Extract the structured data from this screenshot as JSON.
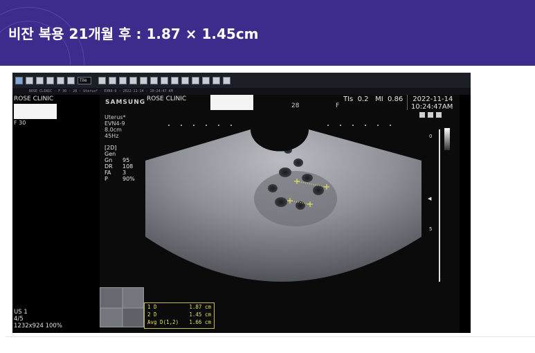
{
  "slide": {
    "title": "비잔 복용 21개월 후 :  1.87 × 1.45cm",
    "banner_color": "#3e2b8c"
  },
  "toolbar": {
    "buttons": [
      "patient-icon",
      "worklist-icon",
      "pointer-icon",
      "zoom-icon",
      "user-icon",
      "compare-icon",
      "tile-icon",
      "layout-icon",
      "grid-icon",
      "sound-icon",
      "export-icon",
      "print-icon",
      "window-icon",
      "print2-icon",
      "filter-icon",
      "report-icon",
      "capture-icon",
      "settings-icon",
      "clipboard-icon"
    ],
    "tile_label": "Tile",
    "status_text": "ROSE CLINIC  ·  F 30  ·  28  ·  Uterus*  ·  EVN4-9  ·  2022-11-14  ·  10:24:47 AM"
  },
  "left_panel": {
    "clinic": "ROSE CLINIC",
    "sex_age": "F 30",
    "series": "US 1",
    "frame": "4/5",
    "resolution": "1232x924 100%"
  },
  "us_header": {
    "brand": "SAMSUNG",
    "clinic": "ROSE CLINIC",
    "age": "28",
    "sex": "F",
    "tis_label": "TIs",
    "tis_value": "0.2",
    "mi_label": "MI",
    "mi_value": "0.86",
    "date": "2022-11-14",
    "time": "10:24:47AM"
  },
  "acquisition": {
    "preset": "Uterus*",
    "probe": "EVN4-9",
    "depth": "8.0cm",
    "frequency": "45Hz"
  },
  "mode": {
    "name": "[2D]",
    "gen": "Gen",
    "params": [
      {
        "k": "Gn",
        "v": "95"
      },
      {
        "k": "DR",
        "v": "108"
      },
      {
        "k": "FA",
        "v": "3"
      },
      {
        "k": "P",
        "v": "90%"
      }
    ]
  },
  "scale": {
    "top": "0",
    "mid": "5"
  },
  "measurements": [
    {
      "k": "1  D",
      "v": "1.87 cm"
    },
    {
      "k": "2  D",
      "v": "1.45 cm"
    },
    {
      "k": "   Avg D(1,2)",
      "v": "1.66 cm"
    }
  ],
  "colors": {
    "caliper": "#e8e05a",
    "background": "#000000"
  }
}
